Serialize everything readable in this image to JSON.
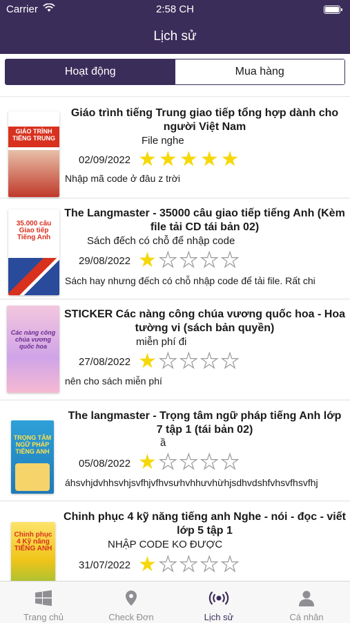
{
  "status_bar": {
    "carrier": "Carrier",
    "time": "2:58 CH"
  },
  "header": {
    "title": "Lịch sử"
  },
  "segments": {
    "active": "Hoạt động",
    "inactive": "Mua hàng"
  },
  "items": [
    {
      "title": "Giáo trình tiếng Trung giao tiếp tổng hợp dành cho người Việt Nam",
      "subtitle": "File nghe",
      "date": "02/09/2022",
      "rating": 5,
      "comment": "Nhập mã code ở đâu z trời",
      "cover_text": "GIÁO TRÌNH TIẾNG TRUNG",
      "cover_color": "#d8321f"
    },
    {
      "title": "The Langmaster - 35000 câu giao tiếp tiếng Anh (Kèm file tải CD tái bản 02)",
      "subtitle": "Sách đếch có chỗ để nhập code",
      "date": "29/08/2022",
      "rating": 1,
      "comment": "Sách hay nhưng đếch có chỗ nhập code để tải file. Rất chi",
      "cover_text": "35.000 câu Giao tiếp Tiếng Anh",
      "cover_color": "#2a4a9b"
    },
    {
      "title": "STICKER Các nàng công chúa vương quốc hoa - Hoa tường vi (sách bản quyền)",
      "subtitle": "miễn phí đi",
      "date": "27/08/2022",
      "rating": 1,
      "comment": "nên cho sách miễn phí",
      "cover_text": "Các nàng công chúa vương quốc hoa",
      "cover_color": "#e89bc4"
    },
    {
      "title": "The langmaster - Trọng tâm ngữ pháp tiếng Anh lớp 7 tập 1 (tái bản 02)",
      "subtitle": "ầ",
      "date": "05/08/2022",
      "rating": 1,
      "comment": "áhsvhjdvhhsvhjsvfhjvfhvsưhvhhưvhừhjsdhvdshfvhsvfhsvfhj",
      "cover_text": "TRỌNG TÂM NGỮ PHÁP TIẾNG ANH",
      "cover_color": "#2ea0d8"
    },
    {
      "title": "Chinh phục 4 kỹ năng tiếng anh Nghe - nói - đọc - viết lớp 5 tập 1",
      "subtitle": "NHẬP CODE KO ĐƯỢC",
      "date": "31/07/2022",
      "rating": 1,
      "comment": "",
      "cover_text": "Chinh phục 4 Kỹ năng TIẾNG ANH",
      "cover_color": "#f0c419"
    }
  ],
  "tabbar": {
    "tabs": [
      {
        "label": "Trang chủ",
        "icon": "windows-icon"
      },
      {
        "label": "Check Đơn",
        "icon": "location-pin-icon"
      },
      {
        "label": "Lịch sử",
        "icon": "broadcast-icon"
      },
      {
        "label": "Cá nhân",
        "icon": "person-icon"
      }
    ]
  }
}
